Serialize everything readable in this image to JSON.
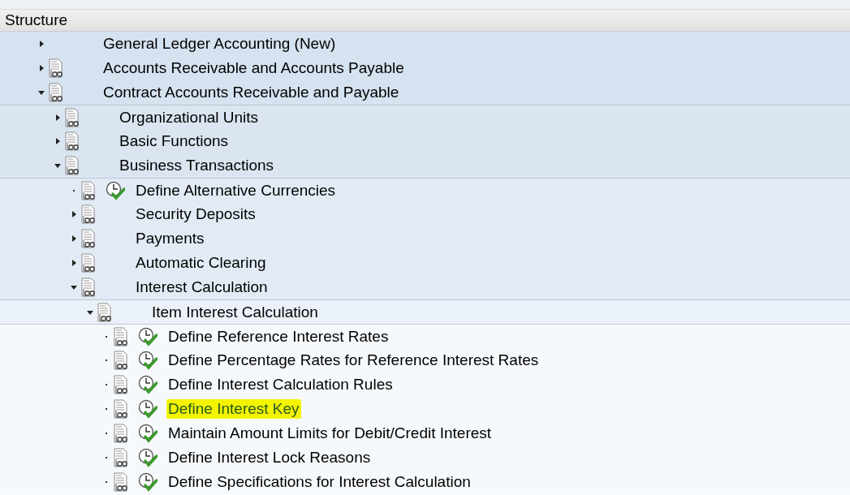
{
  "header": {
    "title": "Structure"
  },
  "tree": [
    {
      "label": "General Ledger Accounting (New)",
      "kind": "folder",
      "expanded": false,
      "doc_icon": false
    },
    {
      "label": "Accounts Receivable and Accounts Payable",
      "kind": "folder",
      "expanded": false,
      "doc_icon": true
    },
    {
      "label": "Contract Accounts Receivable and Payable",
      "kind": "folder",
      "expanded": true,
      "doc_icon": true,
      "children": [
        {
          "label": "Organizational Units",
          "kind": "folder",
          "expanded": false,
          "doc_icon": true
        },
        {
          "label": "Basic Functions",
          "kind": "folder",
          "expanded": false,
          "doc_icon": true
        },
        {
          "label": "Business Transactions",
          "kind": "folder",
          "expanded": true,
          "doc_icon": true,
          "children": [
            {
              "label": "Define Alternative Currencies",
              "kind": "activity",
              "doc_icon": true,
              "highlighted": false
            },
            {
              "label": "Security Deposits",
              "kind": "folder",
              "expanded": false,
              "doc_icon": true
            },
            {
              "label": "Payments",
              "kind": "folder",
              "expanded": false,
              "doc_icon": true
            },
            {
              "label": "Automatic Clearing",
              "kind": "folder",
              "expanded": false,
              "doc_icon": true
            },
            {
              "label": "Interest Calculation",
              "kind": "folder",
              "expanded": true,
              "doc_icon": true,
              "children": [
                {
                  "label": "Item Interest Calculation",
                  "kind": "folder",
                  "expanded": true,
                  "doc_icon": true,
                  "children": [
                    {
                      "label": "Define Reference Interest Rates",
                      "kind": "activity",
                      "doc_icon": true,
                      "highlighted": false
                    },
                    {
                      "label": "Define Percentage Rates for Reference Interest Rates",
                      "kind": "activity",
                      "doc_icon": true,
                      "highlighted": false
                    },
                    {
                      "label": "Define Interest Calculation Rules",
                      "kind": "activity",
                      "doc_icon": true,
                      "highlighted": false
                    },
                    {
                      "label": "Define Interest Key",
                      "kind": "activity",
                      "doc_icon": true,
                      "highlighted": true
                    },
                    {
                      "label": "Maintain Amount Limits for Debit/Credit Interest",
                      "kind": "activity",
                      "doc_icon": true,
                      "highlighted": false
                    },
                    {
                      "label": "Define Interest Lock Reasons",
                      "kind": "activity",
                      "doc_icon": true,
                      "highlighted": false
                    },
                    {
                      "label": "Define Specifications for Interest Calculation",
                      "kind": "activity",
                      "doc_icon": true,
                      "highlighted": false
                    }
                  ]
                }
              ]
            }
          ]
        }
      ]
    }
  ]
}
